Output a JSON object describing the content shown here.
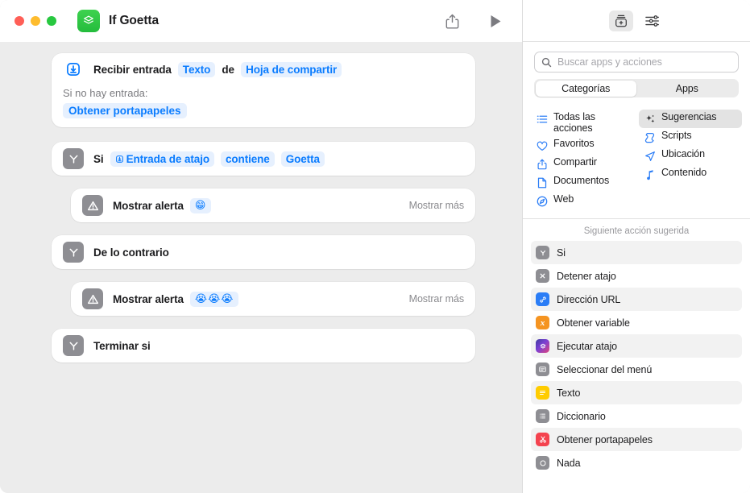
{
  "window": {
    "title": "If Goetta",
    "app_icon": "shortcuts-app-icon",
    "traffic_lights": [
      "close",
      "minimize",
      "zoom"
    ],
    "toolbar": {
      "share_label": "share-icon",
      "run_label": "play-icon"
    }
  },
  "workflow": {
    "actions": [
      {
        "id": "receive-input",
        "icon": "tray-arrow-down-icon",
        "icon_style": "blue-outline",
        "title": "Recibir entrada",
        "token1": "Texto",
        "connector_word": "de",
        "token2": "Hoja de compartir",
        "sub_label": "Si no hay entrada:",
        "sub_token": "Obtener portapapeles"
      },
      {
        "id": "if",
        "icon": "branch-y-icon",
        "title": "Si",
        "token1": "Entrada de atajo",
        "token2": "contiene",
        "token3": "Goetta"
      },
      {
        "id": "show-alert-true",
        "icon": "warning-triangle-icon",
        "title": "Mostrar alerta",
        "token1": "😁",
        "show_more": "Mostrar más",
        "indent": true
      },
      {
        "id": "otherwise",
        "icon": "branch-y-icon",
        "title": "De lo contrario"
      },
      {
        "id": "show-alert-false",
        "icon": "warning-triangle-icon",
        "title": "Mostrar alerta",
        "token1": "😭😭😭",
        "show_more": "Mostrar más",
        "indent": true
      },
      {
        "id": "end-if",
        "icon": "branch-y-icon",
        "title": "Terminar si"
      }
    ]
  },
  "sidebar": {
    "toolbar": {
      "library_button": "action-library-icon",
      "settings_button": "sliders-icon"
    },
    "search": {
      "placeholder": "Buscar apps y acciones",
      "value": "",
      "icon": "search-icon"
    },
    "segmented": {
      "options": [
        "Categorías",
        "Apps"
      ],
      "selected": "Categorías"
    },
    "categories_left": [
      {
        "label": "Todas las acciones",
        "icon": "list-icon",
        "selected": false
      },
      {
        "label": "Favoritos",
        "icon": "heart-icon",
        "selected": false
      },
      {
        "label": "Compartir",
        "icon": "share-icon",
        "selected": false
      },
      {
        "label": "Documentos",
        "icon": "document-icon",
        "selected": false
      },
      {
        "label": "Web",
        "icon": "compass-icon",
        "selected": false
      }
    ],
    "categories_right": [
      {
        "label": "Sugerencias",
        "icon": "sparkles-icon",
        "selected": true
      },
      {
        "label": "Scripts",
        "icon": "scroll-icon",
        "selected": false
      },
      {
        "label": "Ubicación",
        "icon": "location-arrow-icon",
        "selected": false
      },
      {
        "label": "Contenido",
        "icon": "music-note-icon",
        "selected": false
      }
    ],
    "suggested_header": "Siguiente acción sugerida",
    "suggested_actions": [
      {
        "label": "Si",
        "icon": "branch-y-icon",
        "color": "#8e8e93",
        "glyph": "Y"
      },
      {
        "label": "Detener atajo",
        "icon": "x-mark-icon",
        "color": "#8e8e93",
        "glyph": "✕"
      },
      {
        "label": "Dirección URL",
        "icon": "link-icon",
        "color": "#2b7df6",
        "glyph": "🔗"
      },
      {
        "label": "Obtener variable",
        "icon": "variable-icon",
        "color": "#f59421",
        "glyph": "x"
      },
      {
        "label": "Ejecutar atajo",
        "icon": "shortcuts-icon",
        "color": "#6b4fd8",
        "glyph": ""
      },
      {
        "label": "Seleccionar del menú",
        "icon": "menu-select-icon",
        "color": "#8e8e93",
        "glyph": ""
      },
      {
        "label": "Texto",
        "icon": "text-icon",
        "color": "#ffcc00",
        "glyph": ""
      },
      {
        "label": "Diccionario",
        "icon": "dictionary-icon",
        "color": "#8e8e93",
        "glyph": ""
      },
      {
        "label": "Obtener portapapeles",
        "icon": "scissors-icon",
        "color": "#f4434f",
        "glyph": "✂"
      },
      {
        "label": "Nada",
        "icon": "circle-icon",
        "color": "#8e8e93",
        "glyph": "○"
      }
    ]
  },
  "colors": {
    "accent_blue": "#0a7cff",
    "token_bg": "#e6f0fe",
    "canvas_bg": "#ececec",
    "icon_gray": "#8e8e93",
    "app_green": "#2ec04a"
  }
}
